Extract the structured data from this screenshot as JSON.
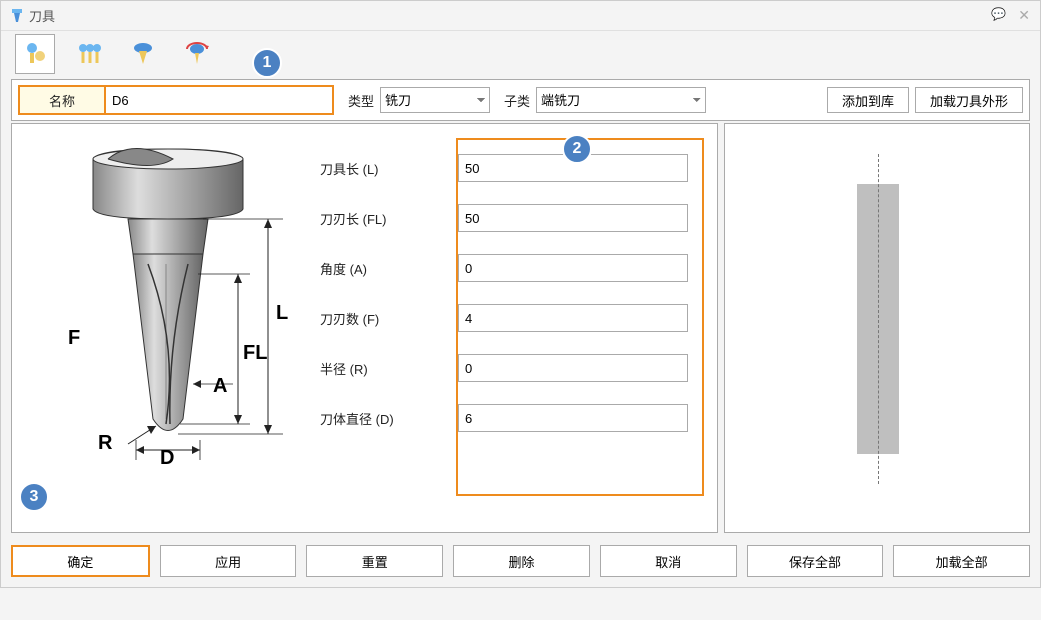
{
  "title": "刀具",
  "toolbar": {
    "icons": [
      "single-tool",
      "triple-tool",
      "holder-tool",
      "rotate-tool"
    ],
    "selected": 0
  },
  "filter": {
    "name_label": "名称",
    "name_value": "D6",
    "type_label": "类型",
    "type_value": "铣刀",
    "sub_label": "子类",
    "sub_value": "端铣刀",
    "add_lib": "添加到库",
    "load_shape": "加载刀具外形"
  },
  "params": {
    "rows": [
      {
        "label": "刀具长 (L)",
        "value": "50"
      },
      {
        "label": "刀刃长 (FL)",
        "value": "50"
      },
      {
        "label": "角度 (A)",
        "value": "0"
      },
      {
        "label": "刀刃数 (F)",
        "value": "4"
      },
      {
        "label": "半径 (R)",
        "value": "0"
      },
      {
        "label": "刀体直径 (D)",
        "value": "6"
      }
    ],
    "diag": {
      "F": "F",
      "R": "R",
      "D": "D",
      "L": "L",
      "FL": "FL",
      "A": "A"
    }
  },
  "badges": {
    "b1": "1",
    "b2": "2",
    "b3": "3"
  },
  "buttons": {
    "ok": "确定",
    "apply": "应用",
    "reset": "重置",
    "delete": "删除",
    "cancel": "取消",
    "save_all": "保存全部",
    "load_all": "加载全部"
  }
}
